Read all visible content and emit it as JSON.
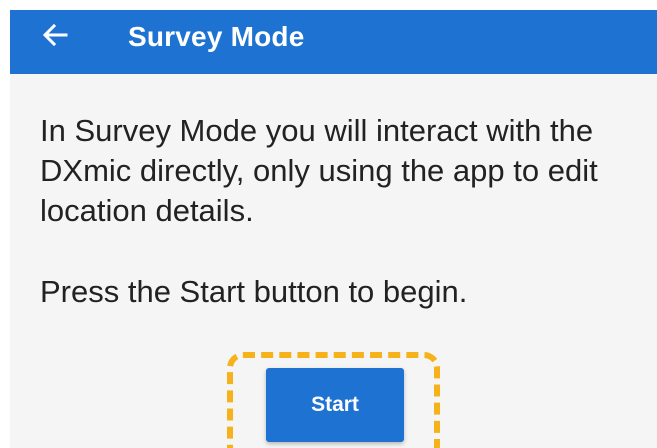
{
  "app_bar": {
    "back_icon": "arrow-back-icon",
    "title": "Survey Mode",
    "background": "#1e73d2"
  },
  "content": {
    "paragraph_1": "In Survey Mode you will interact with the DXmic directly, only using the app to edit location details.",
    "paragraph_2": "Press the Start button to begin."
  },
  "start_button": {
    "label": "Start",
    "color": "#1e73d2"
  },
  "highlight": {
    "color": "#f6b21a"
  }
}
